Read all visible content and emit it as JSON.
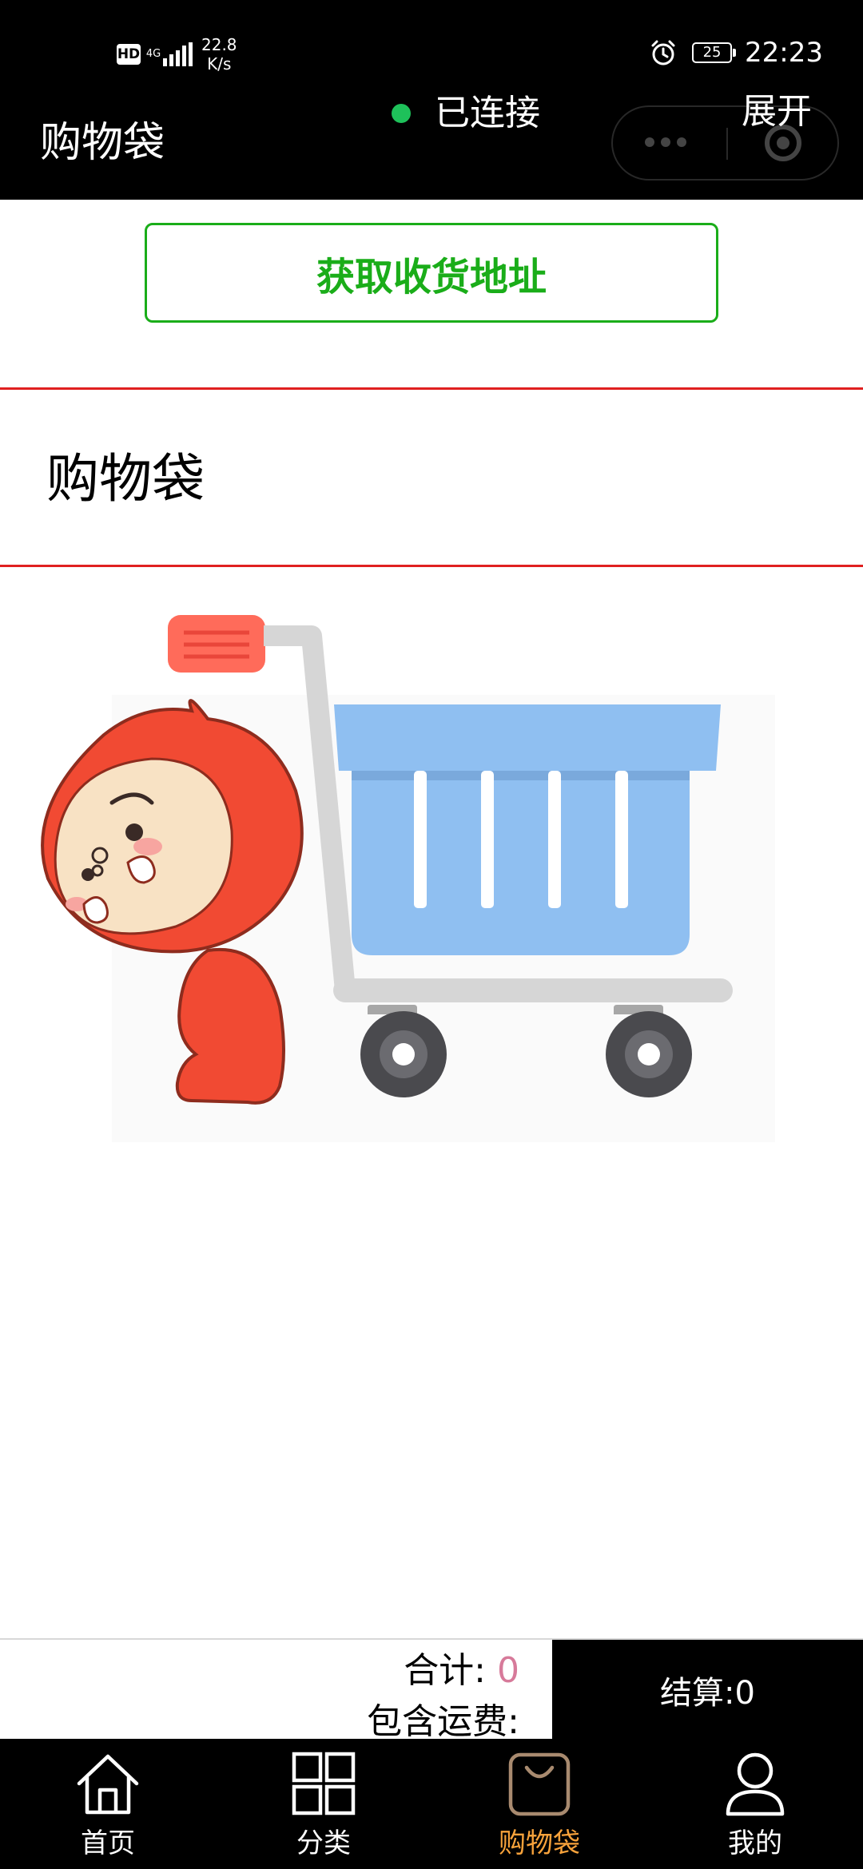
{
  "status_bar": {
    "hd_badge": "HD",
    "network_type": "4G",
    "network_speed_value": "22.8",
    "network_speed_unit": "K/s",
    "battery_level": "25",
    "time": "22:23",
    "icons": [
      "signal-icon",
      "alarm-icon",
      "battery-icon"
    ]
  },
  "nav": {
    "title": "购物袋",
    "connection_status": "已连接",
    "connection_color": "#1ec15a",
    "expand_label": "展开",
    "capsule_icons": [
      "more-dots-icon",
      "close-circle-icon"
    ]
  },
  "address": {
    "button_label": "获取收货地址",
    "accent_color": "#1aad19"
  },
  "section": {
    "title": "购物袋",
    "divider_color": "#e02020"
  },
  "empty_cart": {
    "illustration": "empty-shopping-cart-illustration"
  },
  "summary": {
    "total_label": "合计: ",
    "total_value": "0",
    "shipping_label": "包含运费:",
    "checkout_label": "结算:0"
  },
  "tabbar": {
    "active_color": "#f7a23b",
    "tabs": [
      {
        "label": "首页",
        "icon": "home-icon"
      },
      {
        "label": "分类",
        "icon": "grid-icon"
      },
      {
        "label": "购物袋",
        "icon": "shopping-bag-icon",
        "active": true
      },
      {
        "label": "我的",
        "icon": "user-icon"
      }
    ]
  }
}
